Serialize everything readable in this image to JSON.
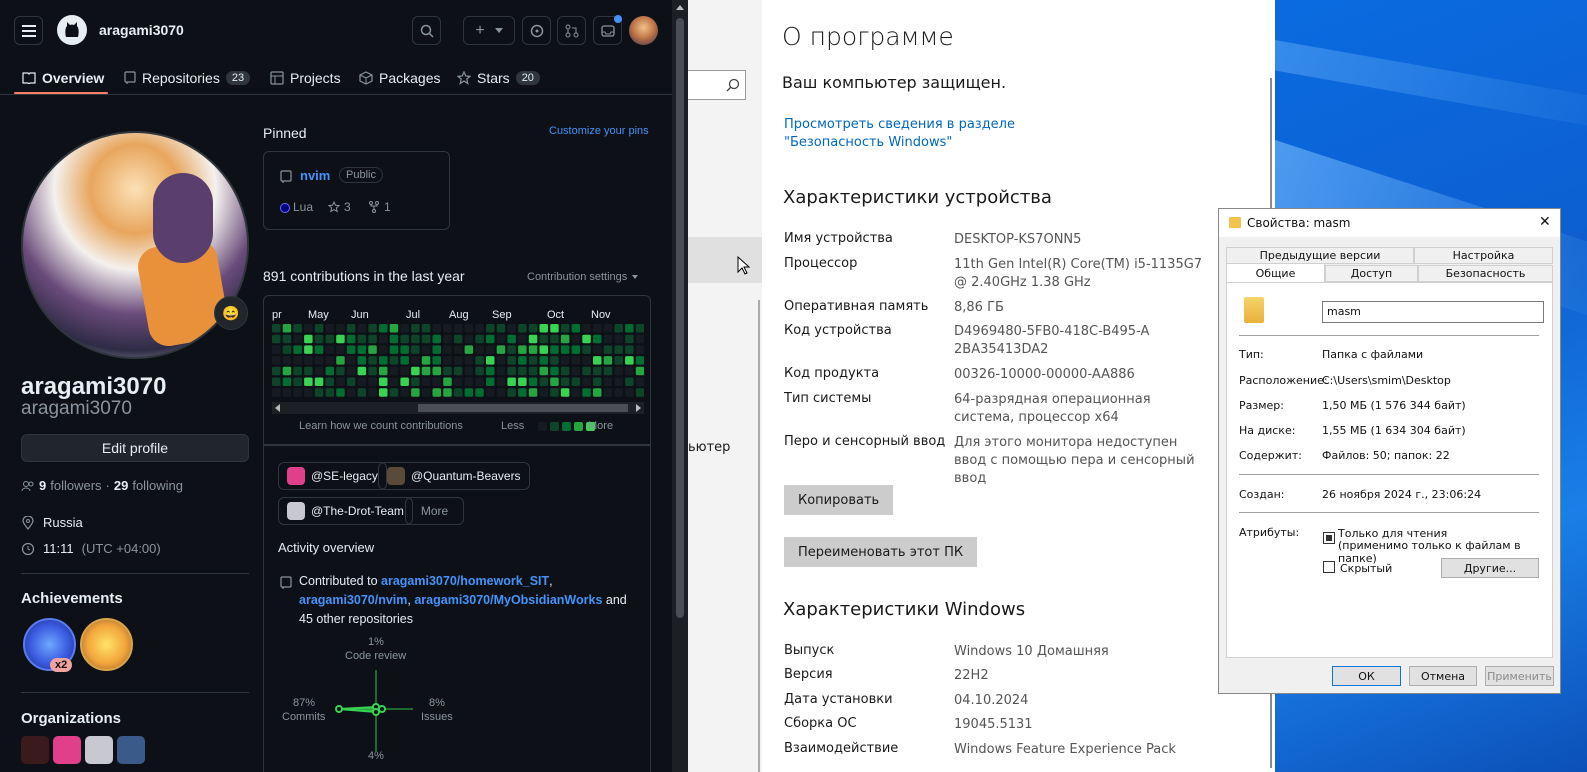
{
  "github": {
    "username": "aragami3070",
    "tabs": [
      {
        "label": "Overview"
      },
      {
        "label": "Repositories",
        "count": "23"
      },
      {
        "label": "Projects"
      },
      {
        "label": "Packages"
      },
      {
        "label": "Stars",
        "count": "20"
      }
    ],
    "profile": {
      "name": "aragami3070",
      "login": "aragami3070",
      "status_emoji": "😄",
      "edit_profile": "Edit profile",
      "followers_count": "9",
      "followers_label": "followers",
      "following_count": "29",
      "following_label": "following",
      "location": "Russia",
      "time": "11:11",
      "timezone": "(UTC +04:00)"
    },
    "achievements": {
      "title": "Achievements",
      "badge_count": "x2"
    },
    "organizations": {
      "title": "Organizations"
    },
    "pinned": {
      "title": "Pinned",
      "customize": "Customize your pins",
      "repo": {
        "name": "nvim",
        "visibility": "Public",
        "language": "Lua",
        "stars": "3",
        "forks": "1",
        "language_color": "#000080"
      }
    },
    "contributions": {
      "title": "891 contributions in the last year",
      "settings": "Contribution settings",
      "months": [
        "pr",
        "May",
        "Jun",
        "Jul",
        "Aug",
        "Sep",
        "Oct",
        "Nov"
      ],
      "learn": "Learn how we count contributions",
      "less": "Less",
      "more": "More"
    },
    "orgs_filter": [
      {
        "label": "@SE-legacy"
      },
      {
        "label": "@Quantum-Beavers"
      },
      {
        "label": "@The-Drot-Team"
      }
    ],
    "more_button": "More",
    "activity": {
      "title": "Activity overview",
      "contributed_to": "Contributed to",
      "repo1": "aragami3070/homework_SIT",
      "repo2": "aragami3070/nvim",
      "repo3": "aragami3070/MyObsidianWorks",
      "others": "and 45 other repositories",
      "code_review_pct": "1%",
      "code_review_label": "Code review",
      "commits_pct": "87%",
      "commits_label": "Commits",
      "issues_pct": "8%",
      "issues_label": "Issues",
      "pr_pct": "4%"
    }
  },
  "middle": {
    "partial_text": "ьютер"
  },
  "about": {
    "title": "О программе",
    "protected": "Ваш компьютер защищен.",
    "security_link": "Просмотреть сведения в разделе \"Безопасность Windows\"",
    "device_title": "Характеристики устройства",
    "specs": [
      {
        "label": "Имя устройства",
        "value": "DESKTOP-KS7ONN5"
      },
      {
        "label": "Процессор",
        "value": "11th Gen Intel(R) Core(TM) i5-1135G7 @ 2.40GHz   1.38 GHz"
      },
      {
        "label": "Оперативная память",
        "value": "8,86 ГБ"
      },
      {
        "label": "Код устройства",
        "value": "D4969480-5FB0-418C-B495-A2BA35413DA2"
      },
      {
        "label": "Код продукта",
        "value": "00326-10000-00000-AA886"
      },
      {
        "label": "Тип системы",
        "value": "64-разрядная операционная система, процессор x64"
      },
      {
        "label": "Перо и сенсорный ввод",
        "value": "Для этого монитора недоступен ввод с помощью пера и сенсорный ввод"
      }
    ],
    "copy_button": "Копировать",
    "rename_button": "Переименовать этот ПК",
    "windows_title": "Характеристики Windows",
    "win_specs": [
      {
        "label": "Выпуск",
        "value": "Windows 10 Домашняя"
      },
      {
        "label": "Версия",
        "value": "22H2"
      },
      {
        "label": "Дата установки",
        "value": "04.10.2024"
      },
      {
        "label": "Сборка ОС",
        "value": "19045.5131"
      },
      {
        "label": "Взаимодействие",
        "value": "Windows Feature Experience Pack"
      }
    ]
  },
  "props": {
    "title": "Свойства: masm",
    "close": "✕",
    "tabs_row1": [
      "Предыдущие версии",
      "Настройка"
    ],
    "tabs_row2": [
      "Общие",
      "Доступ",
      "Безопасность"
    ],
    "name_value": "masm",
    "type_label": "Тип:",
    "type_value": "Папка с файлами",
    "location_label": "Расположение:",
    "location_value": "C:\\Users\\smim\\Desktop",
    "size_label": "Размер:",
    "size_value": "1,50 МБ (1 576 344 байт)",
    "disk_label": "На диске:",
    "disk_value": "1,55 МБ (1 634 304 байт)",
    "contains_label": "Содержит:",
    "contains_value": "Файлов: 50; папок: 22",
    "created_label": "Создан:",
    "created_value": "26 ноября 2024 г., 23:06:24",
    "attrs_label": "Атрибуты:",
    "readonly_label": "Только для чтения",
    "readonly_note": "(применимо только к файлам в папке)",
    "hidden_label": "Скрытый",
    "other_button": "Другие...",
    "ok": "ОК",
    "cancel": "Отмена",
    "apply": "Применить"
  }
}
